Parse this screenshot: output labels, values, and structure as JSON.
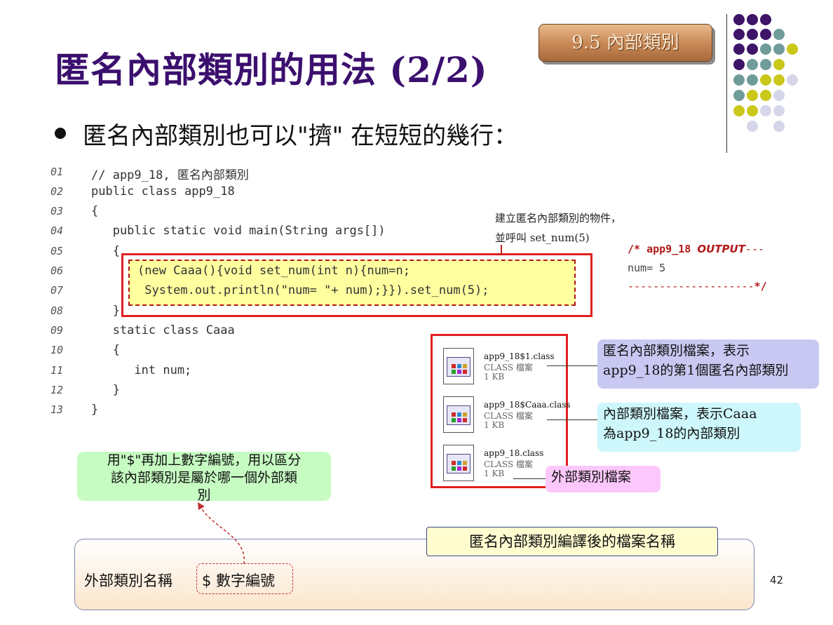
{
  "slide": {
    "title": "匿名內部類別的用法 (2/2)",
    "section_badge": "9.5 內部類別",
    "bullet": "匿名內部類別也可以\"擠\" 在短短的幾行：",
    "page_number": "42"
  },
  "code": {
    "lines": [
      {
        "no": "01",
        "text": "// app9_18, 匿名內部類別"
      },
      {
        "no": "02",
        "text": "public class app9_18"
      },
      {
        "no": "03",
        "text": "{"
      },
      {
        "no": "04",
        "text": "   public static void main(String args[])"
      },
      {
        "no": "05",
        "text": "   {"
      },
      {
        "no": "06",
        "text": "(new Caaa(){void set_num(int n){num=n;"
      },
      {
        "no": "07",
        "text": " System.out.println(\"num= \"+ num);}}).set_num(5);"
      },
      {
        "no": "08",
        "text": "   }"
      },
      {
        "no": "09",
        "text": "   static class Caaa"
      },
      {
        "no": "10",
        "text": "   {"
      },
      {
        "no": "11",
        "text": "      int num;"
      },
      {
        "no": "12",
        "text": "   }"
      },
      {
        "no": "13",
        "text": "}"
      }
    ]
  },
  "annotation": {
    "line1": "建立匿名內部類別的物件，",
    "line2": "並呼叫 set_num(5)"
  },
  "output": {
    "head_prefix": "/* ",
    "head_name": "app9_18 ",
    "head_word": "OUTPUT",
    "head_dashes": "---",
    "line2": "num= 5",
    "footer_dashes": "--------------------",
    "footer_close": "*/"
  },
  "files": [
    {
      "name": "app9_18$1.class",
      "type": "CLASS 檔案",
      "size": "1 KB"
    },
    {
      "name": "app9_18$Caaa.class",
      "type": "CLASS 檔案",
      "size": "1 KB"
    },
    {
      "name": "app9_18.class",
      "type": "CLASS 檔案",
      "size": "1 KB"
    }
  ],
  "callouts": {
    "anon_line1": "匿名內部類別檔案，表示",
    "anon_line2": "app9_18的第1個匿名內部類別",
    "inner_line1": "內部類別檔案，表示Caaa",
    "inner_line2": "為app9_18的內部類別",
    "outer": "外部類別檔案"
  },
  "green_note": {
    "line1": "用\"$\"再加上數字編號，用以區分",
    "line2": "該內部類別是屬於哪一個外部類",
    "line3": "別"
  },
  "bottom": {
    "compile_title": "匿名內部類別編譯後的檔案名稱",
    "outer_name": "外部類別名稱",
    "dollar_number": "$ 數字編號"
  },
  "colors": {
    "title": "#3b0f6e",
    "purple": "#3e1469",
    "teal": "#6f9c9a",
    "olive": "#c9c81b",
    "lavender": "#d6d6ea",
    "red_border": "#e02020",
    "output_red": "#b01818"
  }
}
